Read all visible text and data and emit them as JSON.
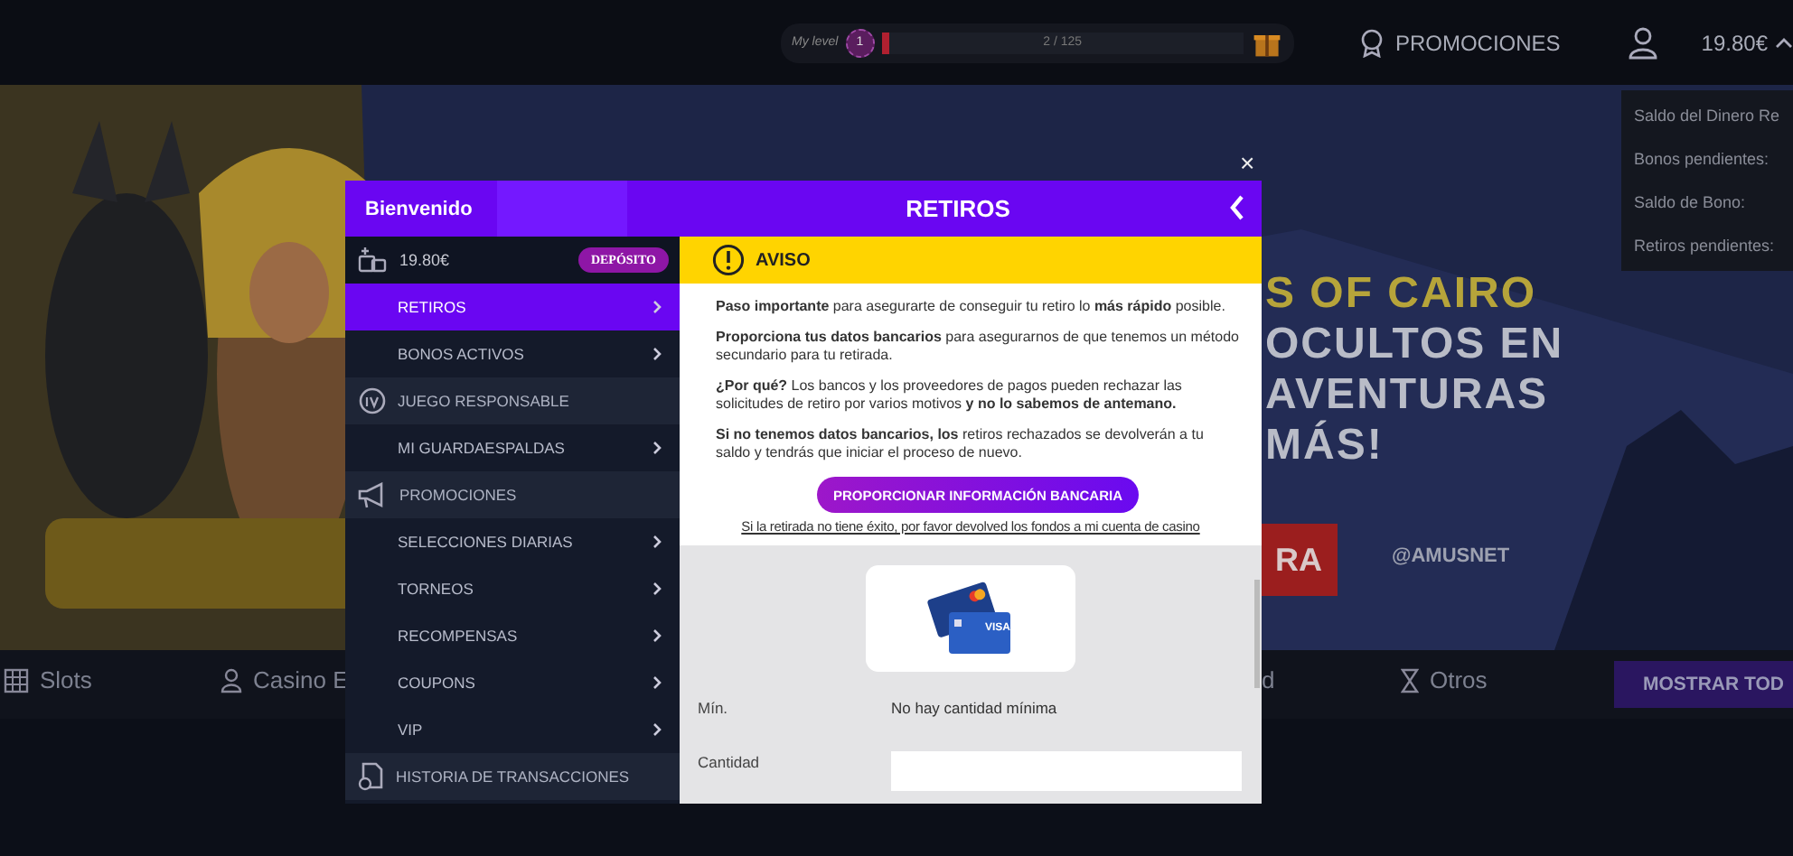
{
  "top_bar": {
    "level_label": "My level",
    "level_badge": "1",
    "level": 0.02,
    "level_reading": "2 / 125",
    "promotions": "PROMOCIONES",
    "balance": "19.80€",
    "balance_expanded": true
  },
  "banner": {
    "kind": "picture",
    "headline": [
      "S OF CAIRO",
      "OCULTOS EN",
      "AVENTURAS",
      "MÁS!"
    ],
    "cta": "RA",
    "provider": "@AMUSNET"
  },
  "categories": [
    {
      "label": "Slots"
    },
    {
      "label": "Casino E"
    },
    {
      "label": "d"
    },
    {
      "label": "Otros"
    }
  ],
  "show_all": "MOSTRAR TOD",
  "balance_menu": [
    "Saldo del Dinero Re",
    "Bonos pendientes:",
    "Saldo de Bono:",
    "Retiros pendientes:"
  ],
  "modal": {
    "welcome": "Bienvenido",
    "title": "RETIROS",
    "close": "×",
    "sidebar": [
      {
        "kind": "balance",
        "label": "19.80€",
        "button": "DEPÓSITO"
      },
      {
        "kind": "item",
        "label": "RETIROS",
        "selected": true
      },
      {
        "kind": "item",
        "label": "BONOS ACTIVOS",
        "selected": false
      },
      {
        "kind": "section",
        "label": "JUEGO RESPONSABLE"
      },
      {
        "kind": "item",
        "label": "MI GUARDAESPALDAS",
        "selected": false
      },
      {
        "kind": "section",
        "label": "PROMOCIONES"
      },
      {
        "kind": "item",
        "label": "SELECCIONES DIARIAS",
        "selected": false
      },
      {
        "kind": "item",
        "label": "TORNEOS",
        "selected": false
      },
      {
        "kind": "item",
        "label": "RECOMPENSAS",
        "selected": false
      },
      {
        "kind": "item",
        "label": "COUPONS",
        "selected": false
      },
      {
        "kind": "item",
        "label": "VIP",
        "selected": false
      },
      {
        "kind": "section",
        "label": "HISTORIA DE TRANSACCIONES"
      }
    ],
    "notice_title": "AVISO",
    "paragraphs": [
      "**Paso importante** para asegurarte de conseguir tu retiro lo **más rápido** posible.",
      "**Proporciona tus datos bancarios** para asegurarnos de que tenemos un método secundario para tu retirada.",
      "**¿Por qué?** Los bancos y los proveedores de pagos pueden rechazar las solicitudes de retiro por varios motivos **y no lo sabemos de antemano.**",
      "**Si no tenemos datos bancarios, los** retiros rechazados se devolverán a tu saldo y tendrás que iniciar el proceso de nuevo."
    ],
    "bank_button": "PROPORCIONAR INFORMACIÓN BANCARIA",
    "return_link": "Si la retirada no tiene éxito, por favor devolved los fondos a mi cuenta de casino",
    "card_text": "VISA",
    "fields": [
      {
        "label": "Mín.",
        "value": "No hay cantidad mínima",
        "kind": "text"
      },
      {
        "label": "Cantidad",
        "kind": "input"
      }
    ]
  }
}
